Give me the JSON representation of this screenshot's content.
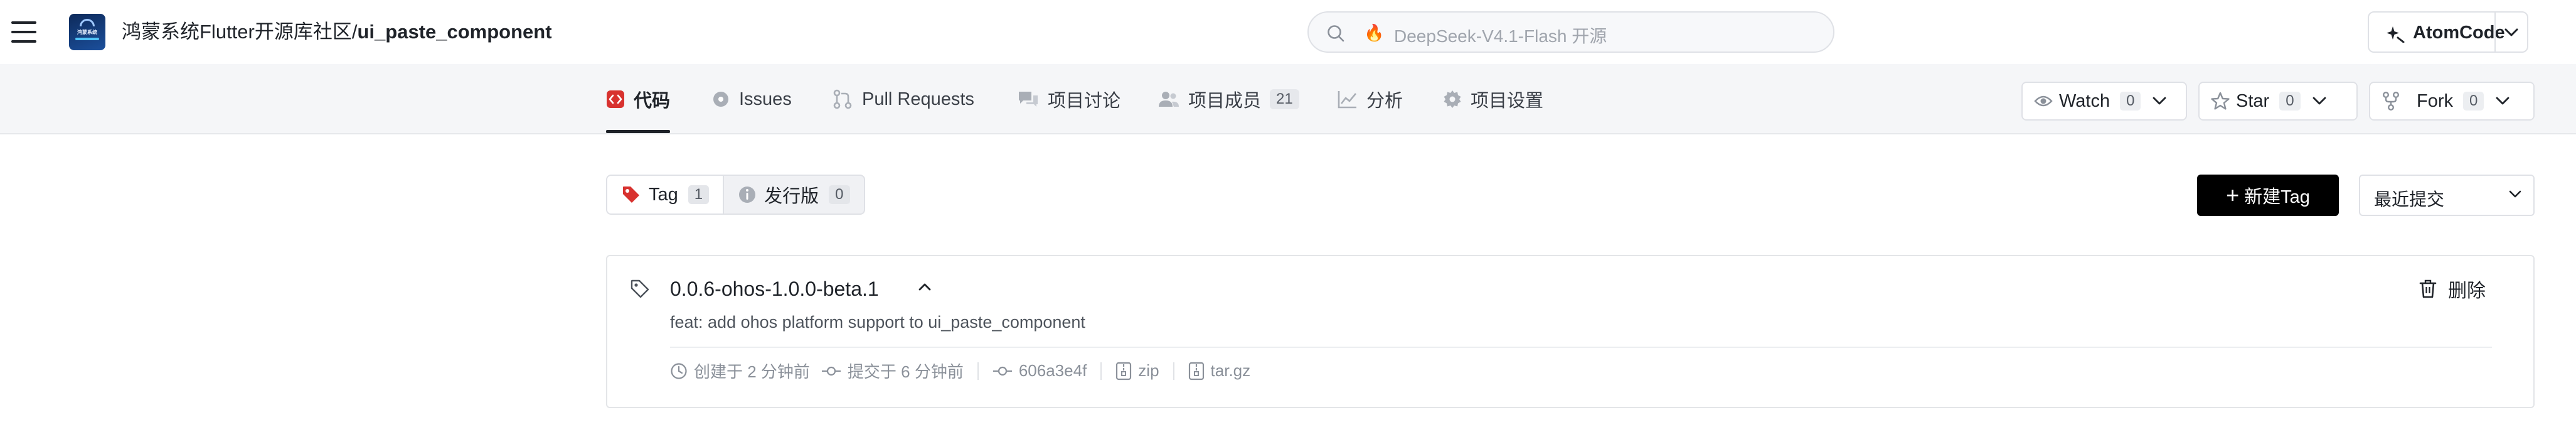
{
  "header": {
    "org_name": "鸿蒙系统Flutter开源库社区",
    "path_separator": "/",
    "repo_name": "ui_paste_component",
    "logo_text": "鸿蒙系统",
    "search_placeholder": "DeepSeek-V4.1-Flash 开源",
    "atomcode_label": "AtomCode"
  },
  "tabs": [
    {
      "label": "代码",
      "icon": "code-icon",
      "active": true
    },
    {
      "label": "Issues",
      "icon": "issues-icon"
    },
    {
      "label": "Pull Requests",
      "icon": "pull-request-icon"
    },
    {
      "label": "项目讨论",
      "icon": "discussion-icon"
    },
    {
      "label": "项目成员",
      "icon": "members-icon",
      "count": "21"
    },
    {
      "label": "分析",
      "icon": "analytics-icon"
    },
    {
      "label": "项目设置",
      "icon": "settings-gear-icon"
    }
  ],
  "repo_actions": {
    "watch": {
      "label": "Watch",
      "count": "0"
    },
    "star": {
      "label": "Star",
      "count": "0"
    },
    "fork": {
      "label": "Fork",
      "count": "0"
    }
  },
  "toolbar": {
    "tag_tab": {
      "label": "Tag",
      "count": "1"
    },
    "release_tab": {
      "label": "发行版",
      "count": "0"
    },
    "new_tag_label": "新建Tag",
    "sort_label": "最近提交"
  },
  "tag_item": {
    "name": "0.0.6-ohos-1.0.0-beta.1",
    "message": "feat: add ohos platform support to ui_paste_component",
    "delete_label": "删除",
    "created": "创建于 2 分钟前",
    "committed": "提交于 6 分钟前",
    "commit_sha": "606a3e4f",
    "zip_label": "zip",
    "targz_label": "tar.gz"
  },
  "colors": {
    "accent_code": "#d8322f",
    "button_primary": "#000000",
    "tabbar_bg": "#f5f6f8"
  }
}
